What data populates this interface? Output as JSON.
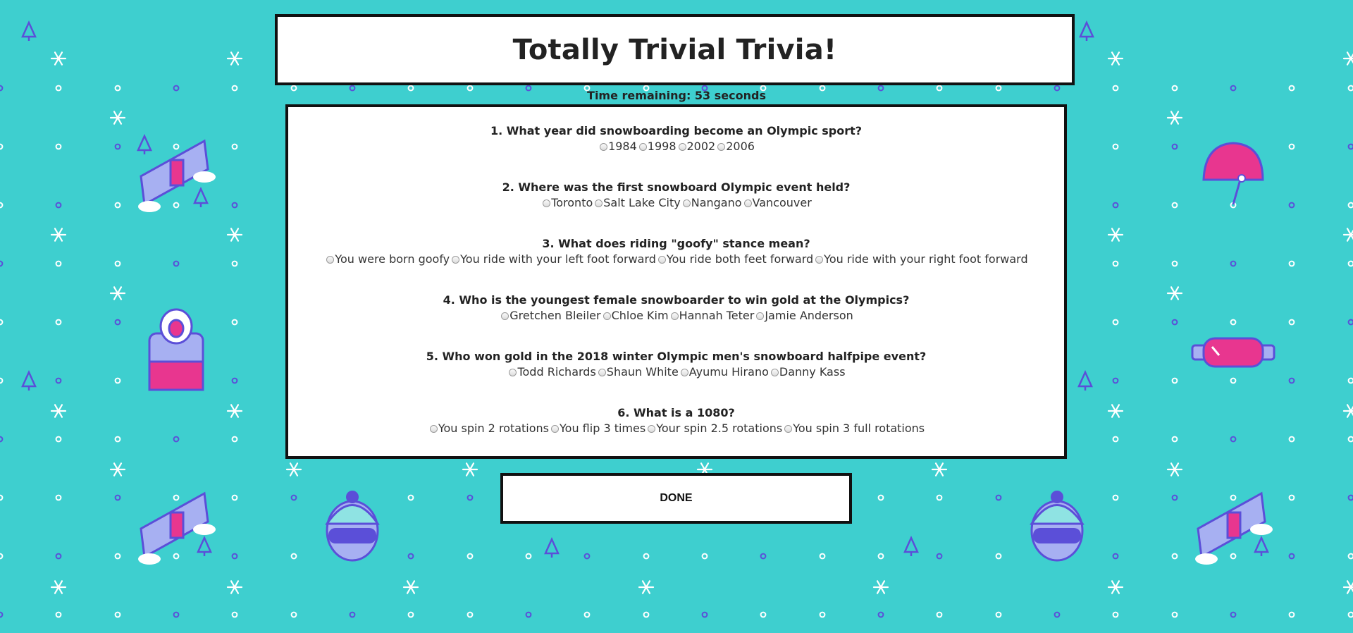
{
  "title": "Totally Trivial Trivia!",
  "timer_text": "Time remaining: 53 seconds",
  "questions": [
    {
      "text": "1. What year did snowboarding become an Olympic sport?",
      "options": [
        "1984",
        "1998",
        "2002",
        "2006"
      ]
    },
    {
      "text": "2. Where was the first snowboard Olympic event held?",
      "options": [
        "Toronto",
        "Salt Lake City",
        "Nangano",
        "Vancouver"
      ]
    },
    {
      "text": "3. What does riding \"goofy\" stance mean?",
      "options": [
        "You were born goofy",
        "You ride with your left foot forward",
        "You ride both feet forward",
        "You ride with your right foot forward"
      ]
    },
    {
      "text": "4. Who is the youngest female snowboarder to win gold at the Olympics?",
      "options": [
        "Gretchen Bleiler",
        "Chloe Kim",
        "Hannah Teter",
        "Jamie Anderson"
      ]
    },
    {
      "text": "5. Who won gold in the 2018 winter Olympic men's snowboard halfpipe event?",
      "options": [
        "Todd Richards",
        "Shaun White",
        "Ayumu Hirano",
        "Danny Kass"
      ]
    },
    {
      "text": "6. What is a 1080?",
      "options": [
        "You spin 2 rotations",
        "You flip 3 times",
        "Your spin 2.5 rotations",
        "You spin 3 full rotations"
      ]
    }
  ],
  "done_label": "DONE",
  "colors": {
    "background": "#3ecfcf",
    "pattern_purple": "#5b4fd8",
    "pattern_pink": "#e8368f",
    "pattern_light": "#a7b0f2",
    "pattern_white": "#ffffff"
  }
}
